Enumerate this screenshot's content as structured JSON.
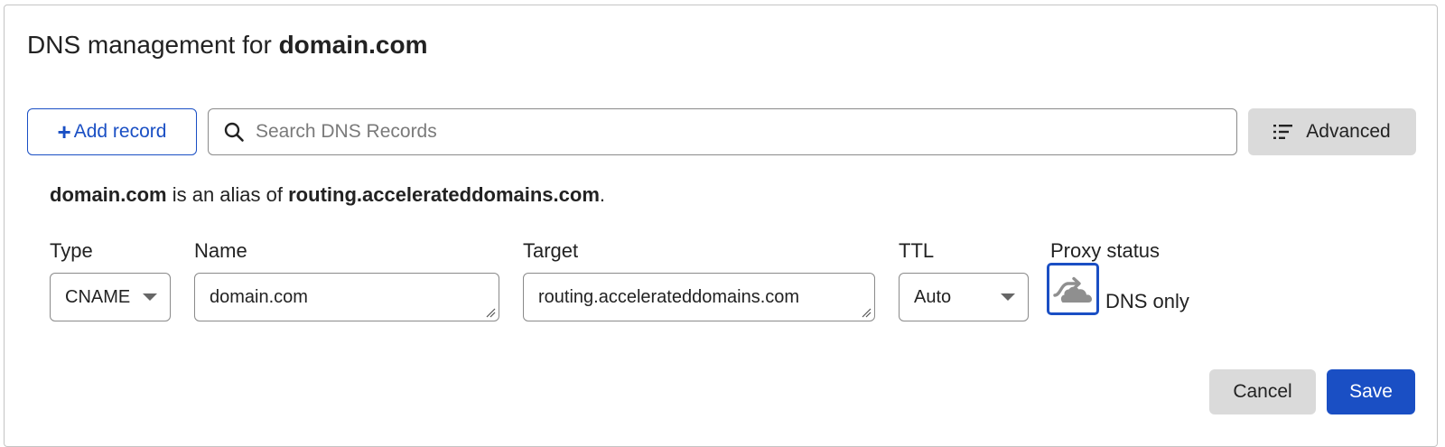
{
  "header": {
    "title_prefix": "DNS management for",
    "title_domain": "domain.com"
  },
  "toolbar": {
    "add_record_icon": "plus-icon",
    "add_record_label": "Add record",
    "search_icon": "search-icon",
    "search_placeholder": "Search DNS Records",
    "search_value": "",
    "advanced_icon": "filter-list-icon",
    "advanced_label": "Advanced"
  },
  "alias_note": {
    "domain": "domain.com",
    "middle": "is an alias of",
    "target": "routing.accelerateddomains.com",
    "end": "."
  },
  "record_form": {
    "type_label": "Type",
    "type_value": "CNAME",
    "name_label": "Name",
    "name_value": "domain.com",
    "target_label": "Target",
    "target_value": "routing.accelerateddomains.com",
    "ttl_label": "TTL",
    "ttl_value": "Auto",
    "proxy_label": "Proxy status",
    "proxy_icon": "cloud-dns-only-icon",
    "proxy_value": "DNS only"
  },
  "actions": {
    "cancel_label": "Cancel",
    "save_label": "Save"
  },
  "colors": {
    "accent": "#1a4fc4",
    "secondary_button": "#dadada",
    "border": "#8a8a8a"
  }
}
